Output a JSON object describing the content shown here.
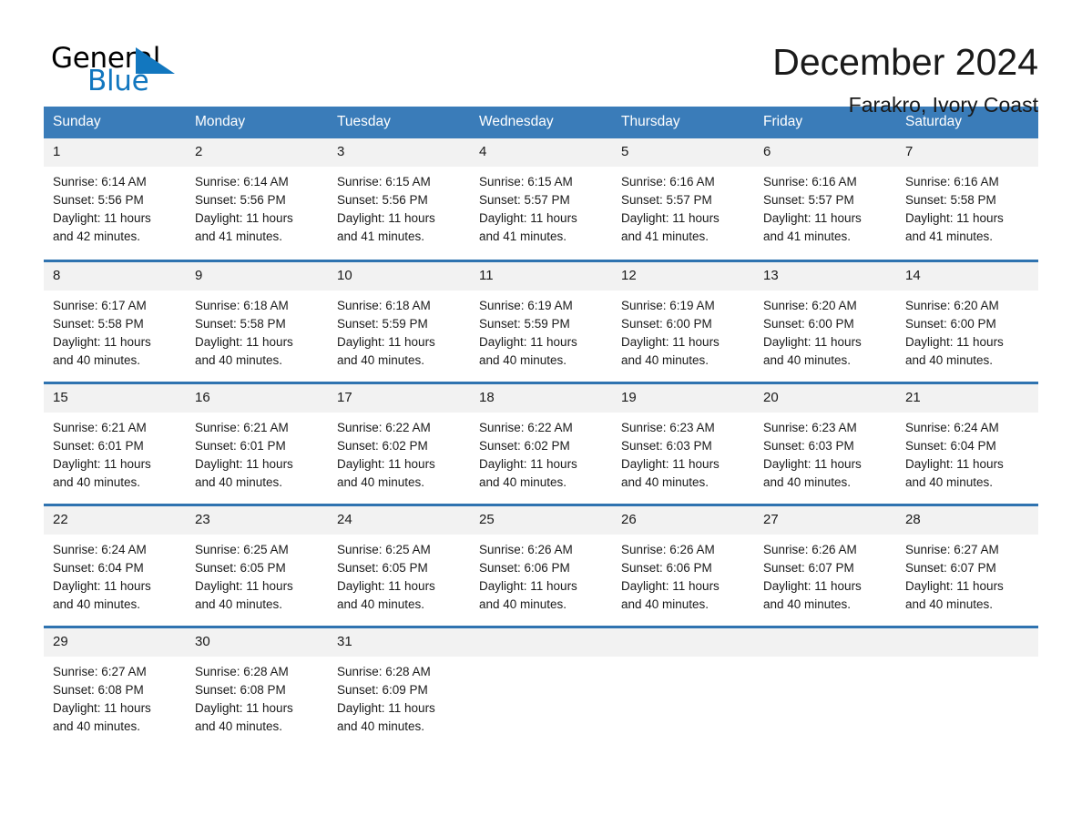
{
  "brand": {
    "name_top": "General",
    "name_bottom": "Blue",
    "accent_color": "#1277bf"
  },
  "header": {
    "month_title": "December 2024",
    "location": "Farakro, Ivory Coast"
  },
  "theme": {
    "header_blue": "#3a7cb9",
    "row_divider_blue": "#2f73b0",
    "daynum_band": "#f2f2f2"
  },
  "calendar": {
    "weekday_headers": [
      "Sunday",
      "Monday",
      "Tuesday",
      "Wednesday",
      "Thursday",
      "Friday",
      "Saturday"
    ],
    "weeks": [
      [
        {
          "day": "1",
          "sunrise": "Sunrise: 6:14 AM",
          "sunset": "Sunset: 5:56 PM",
          "daylight_1": "Daylight: 11 hours",
          "daylight_2": "and 42 minutes."
        },
        {
          "day": "2",
          "sunrise": "Sunrise: 6:14 AM",
          "sunset": "Sunset: 5:56 PM",
          "daylight_1": "Daylight: 11 hours",
          "daylight_2": "and 41 minutes."
        },
        {
          "day": "3",
          "sunrise": "Sunrise: 6:15 AM",
          "sunset": "Sunset: 5:56 PM",
          "daylight_1": "Daylight: 11 hours",
          "daylight_2": "and 41 minutes."
        },
        {
          "day": "4",
          "sunrise": "Sunrise: 6:15 AM",
          "sunset": "Sunset: 5:57 PM",
          "daylight_1": "Daylight: 11 hours",
          "daylight_2": "and 41 minutes."
        },
        {
          "day": "5",
          "sunrise": "Sunrise: 6:16 AM",
          "sunset": "Sunset: 5:57 PM",
          "daylight_1": "Daylight: 11 hours",
          "daylight_2": "and 41 minutes."
        },
        {
          "day": "6",
          "sunrise": "Sunrise: 6:16 AM",
          "sunset": "Sunset: 5:57 PM",
          "daylight_1": "Daylight: 11 hours",
          "daylight_2": "and 41 minutes."
        },
        {
          "day": "7",
          "sunrise": "Sunrise: 6:16 AM",
          "sunset": "Sunset: 5:58 PM",
          "daylight_1": "Daylight: 11 hours",
          "daylight_2": "and 41 minutes."
        }
      ],
      [
        {
          "day": "8",
          "sunrise": "Sunrise: 6:17 AM",
          "sunset": "Sunset: 5:58 PM",
          "daylight_1": "Daylight: 11 hours",
          "daylight_2": "and 40 minutes."
        },
        {
          "day": "9",
          "sunrise": "Sunrise: 6:18 AM",
          "sunset": "Sunset: 5:58 PM",
          "daylight_1": "Daylight: 11 hours",
          "daylight_2": "and 40 minutes."
        },
        {
          "day": "10",
          "sunrise": "Sunrise: 6:18 AM",
          "sunset": "Sunset: 5:59 PM",
          "daylight_1": "Daylight: 11 hours",
          "daylight_2": "and 40 minutes."
        },
        {
          "day": "11",
          "sunrise": "Sunrise: 6:19 AM",
          "sunset": "Sunset: 5:59 PM",
          "daylight_1": "Daylight: 11 hours",
          "daylight_2": "and 40 minutes."
        },
        {
          "day": "12",
          "sunrise": "Sunrise: 6:19 AM",
          "sunset": "Sunset: 6:00 PM",
          "daylight_1": "Daylight: 11 hours",
          "daylight_2": "and 40 minutes."
        },
        {
          "day": "13",
          "sunrise": "Sunrise: 6:20 AM",
          "sunset": "Sunset: 6:00 PM",
          "daylight_1": "Daylight: 11 hours",
          "daylight_2": "and 40 minutes."
        },
        {
          "day": "14",
          "sunrise": "Sunrise: 6:20 AM",
          "sunset": "Sunset: 6:00 PM",
          "daylight_1": "Daylight: 11 hours",
          "daylight_2": "and 40 minutes."
        }
      ],
      [
        {
          "day": "15",
          "sunrise": "Sunrise: 6:21 AM",
          "sunset": "Sunset: 6:01 PM",
          "daylight_1": "Daylight: 11 hours",
          "daylight_2": "and 40 minutes."
        },
        {
          "day": "16",
          "sunrise": "Sunrise: 6:21 AM",
          "sunset": "Sunset: 6:01 PM",
          "daylight_1": "Daylight: 11 hours",
          "daylight_2": "and 40 minutes."
        },
        {
          "day": "17",
          "sunrise": "Sunrise: 6:22 AM",
          "sunset": "Sunset: 6:02 PM",
          "daylight_1": "Daylight: 11 hours",
          "daylight_2": "and 40 minutes."
        },
        {
          "day": "18",
          "sunrise": "Sunrise: 6:22 AM",
          "sunset": "Sunset: 6:02 PM",
          "daylight_1": "Daylight: 11 hours",
          "daylight_2": "and 40 minutes."
        },
        {
          "day": "19",
          "sunrise": "Sunrise: 6:23 AM",
          "sunset": "Sunset: 6:03 PM",
          "daylight_1": "Daylight: 11 hours",
          "daylight_2": "and 40 minutes."
        },
        {
          "day": "20",
          "sunrise": "Sunrise: 6:23 AM",
          "sunset": "Sunset: 6:03 PM",
          "daylight_1": "Daylight: 11 hours",
          "daylight_2": "and 40 minutes."
        },
        {
          "day": "21",
          "sunrise": "Sunrise: 6:24 AM",
          "sunset": "Sunset: 6:04 PM",
          "daylight_1": "Daylight: 11 hours",
          "daylight_2": "and 40 minutes."
        }
      ],
      [
        {
          "day": "22",
          "sunrise": "Sunrise: 6:24 AM",
          "sunset": "Sunset: 6:04 PM",
          "daylight_1": "Daylight: 11 hours",
          "daylight_2": "and 40 minutes."
        },
        {
          "day": "23",
          "sunrise": "Sunrise: 6:25 AM",
          "sunset": "Sunset: 6:05 PM",
          "daylight_1": "Daylight: 11 hours",
          "daylight_2": "and 40 minutes."
        },
        {
          "day": "24",
          "sunrise": "Sunrise: 6:25 AM",
          "sunset": "Sunset: 6:05 PM",
          "daylight_1": "Daylight: 11 hours",
          "daylight_2": "and 40 minutes."
        },
        {
          "day": "25",
          "sunrise": "Sunrise: 6:26 AM",
          "sunset": "Sunset: 6:06 PM",
          "daylight_1": "Daylight: 11 hours",
          "daylight_2": "and 40 minutes."
        },
        {
          "day": "26",
          "sunrise": "Sunrise: 6:26 AM",
          "sunset": "Sunset: 6:06 PM",
          "daylight_1": "Daylight: 11 hours",
          "daylight_2": "and 40 minutes."
        },
        {
          "day": "27",
          "sunrise": "Sunrise: 6:26 AM",
          "sunset": "Sunset: 6:07 PM",
          "daylight_1": "Daylight: 11 hours",
          "daylight_2": "and 40 minutes."
        },
        {
          "day": "28",
          "sunrise": "Sunrise: 6:27 AM",
          "sunset": "Sunset: 6:07 PM",
          "daylight_1": "Daylight: 11 hours",
          "daylight_2": "and 40 minutes."
        }
      ],
      [
        {
          "day": "29",
          "sunrise": "Sunrise: 6:27 AM",
          "sunset": "Sunset: 6:08 PM",
          "daylight_1": "Daylight: 11 hours",
          "daylight_2": "and 40 minutes."
        },
        {
          "day": "30",
          "sunrise": "Sunrise: 6:28 AM",
          "sunset": "Sunset: 6:08 PM",
          "daylight_1": "Daylight: 11 hours",
          "daylight_2": "and 40 minutes."
        },
        {
          "day": "31",
          "sunrise": "Sunrise: 6:28 AM",
          "sunset": "Sunset: 6:09 PM",
          "daylight_1": "Daylight: 11 hours",
          "daylight_2": "and 40 minutes."
        },
        {
          "day": "",
          "sunrise": "",
          "sunset": "",
          "daylight_1": "",
          "daylight_2": "",
          "empty": true
        },
        {
          "day": "",
          "sunrise": "",
          "sunset": "",
          "daylight_1": "",
          "daylight_2": "",
          "empty": true
        },
        {
          "day": "",
          "sunrise": "",
          "sunset": "",
          "daylight_1": "",
          "daylight_2": "",
          "empty": true
        },
        {
          "day": "",
          "sunrise": "",
          "sunset": "",
          "daylight_1": "",
          "daylight_2": "",
          "empty": true
        }
      ]
    ]
  }
}
